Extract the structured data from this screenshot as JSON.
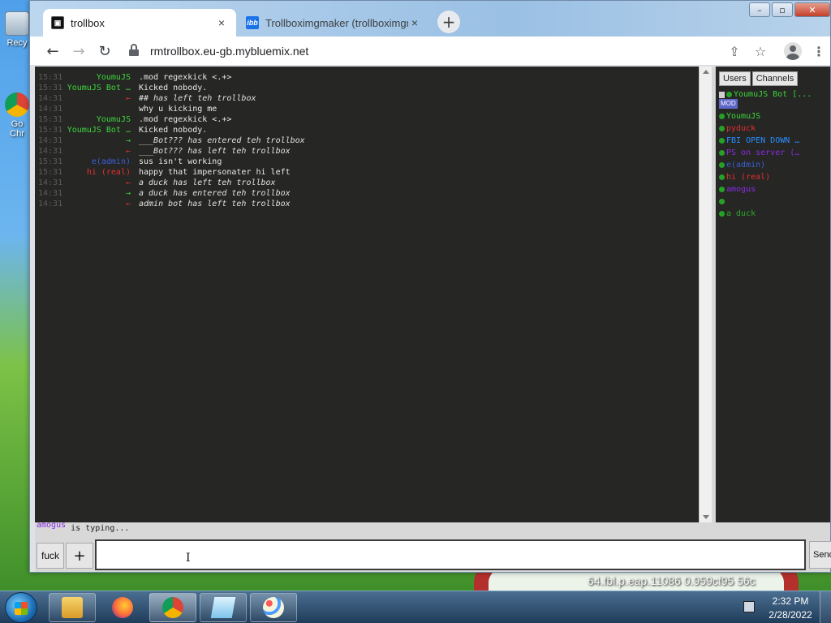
{
  "desktop": {
    "recycle_label": "Recy",
    "chrome_label": "Go Chr",
    "overlay_text": "64.fbl.p.eap.11086         0.959cf95     56c"
  },
  "browser": {
    "tabs": [
      {
        "title": "trollbox",
        "close": "×"
      },
      {
        "title": "Trollboximgmaker (trollboximgm",
        "favicon_text": "ibb",
        "close": "×"
      }
    ],
    "new_tab": "+",
    "window_buttons": {
      "minimize": "–",
      "restore": "▫",
      "close": "✕"
    },
    "nav": {
      "back": "←",
      "forward": "→",
      "reload": "↻"
    },
    "url": "rmtrollbox.eu-gb.mybluemix.net",
    "toolbar_icons": {
      "share": "⇪",
      "star": "☆",
      "menu": "⋮"
    }
  },
  "chat": {
    "messages": [
      {
        "time": "15:31",
        "nick": "YoumuJS",
        "nick_color": "#3cd63c",
        "text": ".mod regexkick <.+>",
        "text_color": "#e9e9e9",
        "italic": false
      },
      {
        "time": "15:31",
        "nick": "YoumuJS Bot …",
        "nick_color": "#3cd63c",
        "text": "Kicked nobody.",
        "text_color": "#e9e9e9",
        "italic": false
      },
      {
        "time": "14:31",
        "nick": "←",
        "nick_color": "#e03030",
        "text": "## has left teh trollbox",
        "text_color": "#e0e0e0",
        "italic": true
      },
      {
        "time": "14:31",
        "nick": "",
        "nick_color": "#3030b0",
        "text": "why u kicking me",
        "text_color": "#e9e9e9",
        "italic": false
      },
      {
        "time": "15:31",
        "nick": "YoumuJS",
        "nick_color": "#3cd63c",
        "text": ".mod regexkick <.+>",
        "text_color": "#e9e9e9",
        "italic": false
      },
      {
        "time": "15:31",
        "nick": "YoumuJS Bot …",
        "nick_color": "#3cd63c",
        "text": "Kicked nobody.",
        "text_color": "#e9e9e9",
        "italic": false
      },
      {
        "time": "14:31",
        "nick": "→",
        "nick_color": "#3cd63c",
        "text": "___Bot??? has entered teh trollbox",
        "text_color": "#e0e0e0",
        "italic": true
      },
      {
        "time": "14:31",
        "nick": "←",
        "nick_color": "#e03030",
        "text": "___Bot??? has left teh trollbox",
        "text_color": "#e0e0e0",
        "italic": true
      },
      {
        "time": "15:31",
        "nick": "e(admin)",
        "nick_color": "#3b5fd6",
        "text": "sus isn't working",
        "text_color": "#e9e9e9",
        "italic": false
      },
      {
        "time": "15:31",
        "nick": "hi (real)",
        "nick_color": "#e03030",
        "text": "happy that impersonater hi left",
        "text_color": "#e9e9e9",
        "italic": false
      },
      {
        "time": "14:31",
        "nick": "←",
        "nick_color": "#e03030",
        "text": "a duck has left teh trollbox",
        "text_color": "#e0e0e0",
        "italic": true
      },
      {
        "time": "14:31",
        "nick": "→",
        "nick_color": "#3cd63c",
        "text": "a duck has entered teh trollbox",
        "text_color": "#e0e0e0",
        "italic": true
      },
      {
        "time": "14:31",
        "nick": "←",
        "nick_color": "#e03030",
        "text": "admin bot has left teh trollbox",
        "text_color": "#e0e0e0",
        "italic": true
      }
    ],
    "typing_user": "amogus",
    "typing_suffix": "is typing..."
  },
  "sidebar": {
    "tabs": [
      "Users",
      "Channels"
    ],
    "mod_badge": "MOD",
    "users": [
      {
        "name": "YoumuJS Bot [...",
        "color": "#3cd63c",
        "icon": "bot"
      },
      {
        "name": "YoumuJS",
        "color": "#3cd63c",
        "icon": "dot"
      },
      {
        "name": "pyduck",
        "color": "#e03030",
        "icon": "dot"
      },
      {
        "name": "FBI OPEN DOWN …",
        "color": "#2a8cff",
        "icon": "dot"
      },
      {
        "name": "PS on server (…",
        "color": "#8a2be2",
        "icon": "dot"
      },
      {
        "name": "e(admin)",
        "color": "#3b5fd6",
        "icon": "dot"
      },
      {
        "name": "hi (real)",
        "color": "#e03030",
        "icon": "dot"
      },
      {
        "name": "amogus",
        "color": "#8a2be2",
        "icon": "dot"
      },
      {
        "name": "",
        "color": "#3030b0",
        "icon": "dot"
      },
      {
        "name": "a duck",
        "color": "#2fa82f",
        "icon": "dot"
      }
    ]
  },
  "composer": {
    "nick_button": "fuck",
    "plus_button": "+",
    "input_value": "",
    "send_button": "Send"
  },
  "taskbar": {
    "time": "2:32 PM",
    "date": "2/28/2022"
  }
}
